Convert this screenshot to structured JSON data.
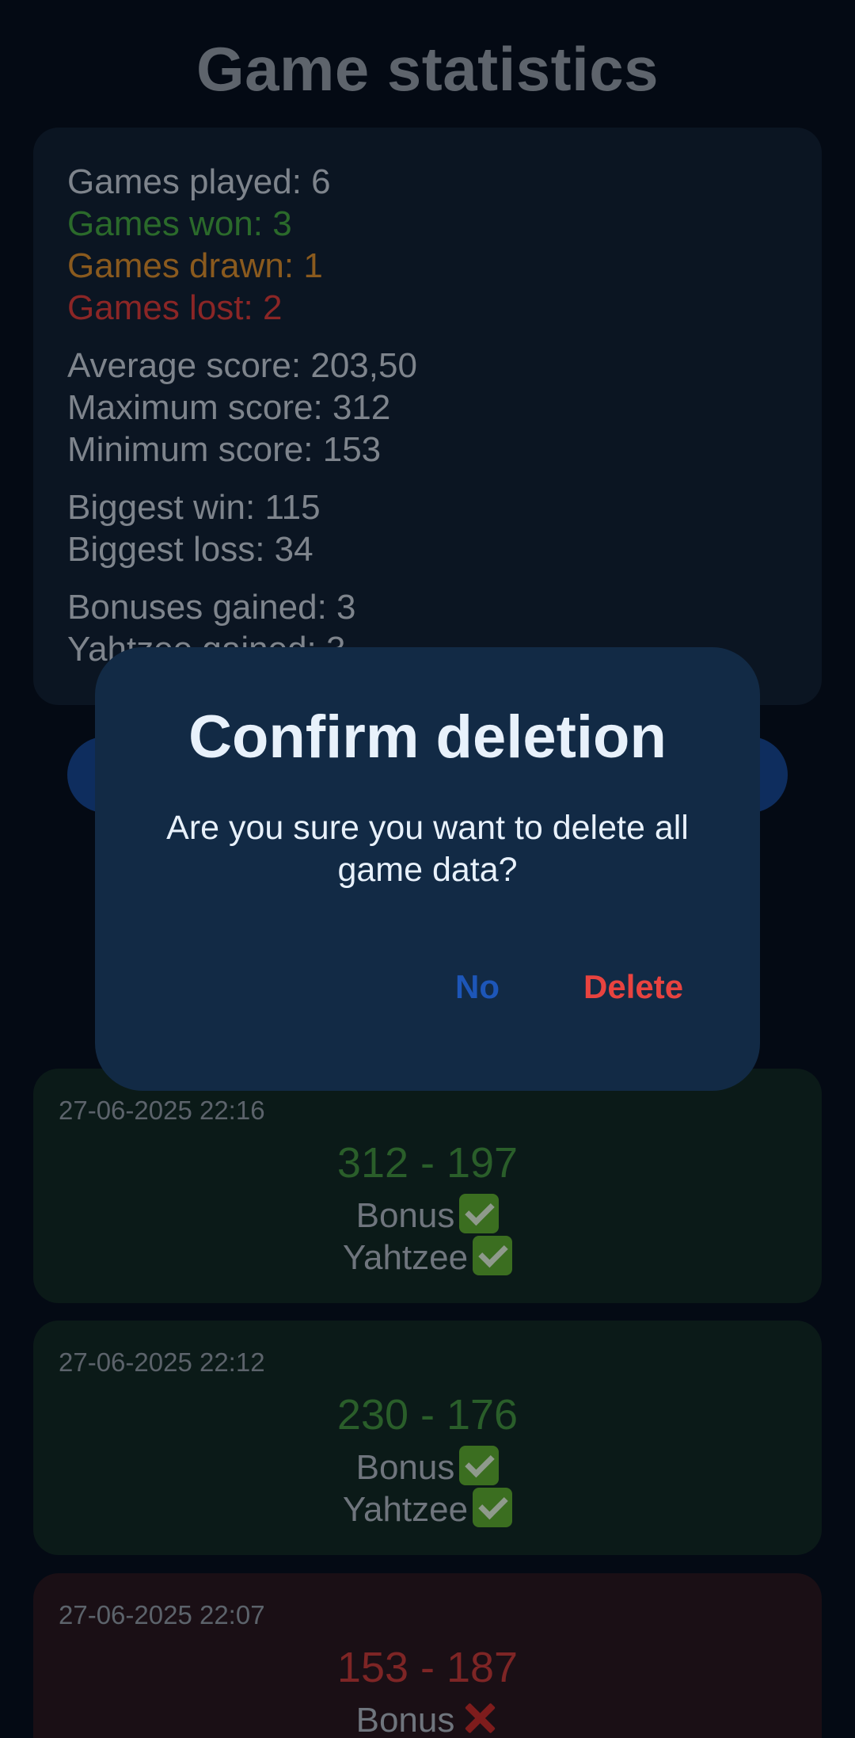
{
  "page": {
    "title": "Game statistics"
  },
  "stats": {
    "games_played": "Games played: 6",
    "games_won": "Games won: 3",
    "games_drawn": "Games drawn: 1",
    "games_lost": "Games lost: 2",
    "average_score": "Average score: 203,50",
    "maximum_score": "Maximum score: 312",
    "minimum_score": "Minimum score: 153",
    "biggest_win": "Biggest win: 115",
    "biggest_loss": "Biggest loss: 34",
    "bonuses_gained": "Bonuses gained: 3",
    "yahtzee_gained": "Yahtzee gained: 3"
  },
  "colors": {
    "won": "#2b6a2b",
    "drawn": "#8a5a1e",
    "lost": "#8b2626",
    "dialog_bg": "#122a45",
    "no_button": "#1d56b8",
    "delete_button": "#e8433f"
  },
  "games": [
    {
      "time": "27-06-2025 22:16",
      "score": "312 - 197",
      "result": "win",
      "bonus_label": "Bonus",
      "bonus_icon": "check-mark-icon",
      "yahtzee_label": "Yahtzee",
      "yahtzee_icon": "check-mark-icon"
    },
    {
      "time": "27-06-2025 22:12",
      "score": "230 - 176",
      "result": "win",
      "bonus_label": "Bonus",
      "bonus_icon": "check-mark-icon",
      "yahtzee_label": "Yahtzee",
      "yahtzee_icon": "check-mark-icon"
    },
    {
      "time": "27-06-2025 22:07",
      "score": "153 - 187",
      "result": "loss",
      "bonus_label": "Bonus",
      "bonus_icon": "cross-mark-icon"
    }
  ],
  "dialog": {
    "title": "Confirm deletion",
    "message": "Are you sure you want to delete all game data?",
    "no_label": "No",
    "delete_label": "Delete"
  }
}
